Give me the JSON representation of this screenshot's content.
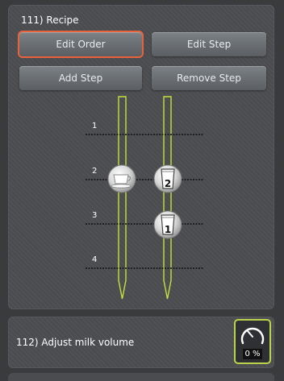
{
  "recipe_panel": {
    "title": "111) Recipe",
    "buttons": {
      "edit_order": "Edit Order",
      "edit_step": "Edit Step",
      "add_step": "Add Step",
      "remove_step": "Remove Step"
    },
    "active_button": "Edit Order",
    "steps": [
      "1",
      "2",
      "3",
      "4"
    ],
    "nodes": [
      {
        "icon": "coffee-cup-icon",
        "number": ""
      },
      {
        "icon": "milk-jug-icon",
        "number": "2"
      },
      {
        "icon": "milk-jug-icon",
        "number": "1"
      }
    ],
    "track_color": "#c5e040",
    "accent_color": "#e8623c"
  },
  "milk_panel": {
    "title": "112) Adjust milk volume",
    "gauge_value": "0 %",
    "gauge_icon": "dial-gauge-icon",
    "gauge_border_color": "#b8d44a"
  }
}
